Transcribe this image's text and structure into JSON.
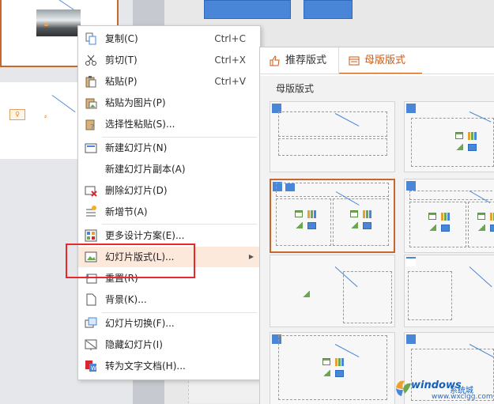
{
  "context_menu": {
    "items": [
      {
        "label": "复制(C)",
        "shortcut": "Ctrl+C",
        "icon": "copy-icon"
      },
      {
        "label": "剪切(T)",
        "shortcut": "Ctrl+X",
        "icon": "cut-icon"
      },
      {
        "label": "粘贴(P)",
        "shortcut": "Ctrl+V",
        "icon": "paste-icon"
      },
      {
        "label": "粘贴为图片(P)",
        "shortcut": "",
        "icon": "paste-as-picture-icon"
      },
      {
        "label": "选择性粘贴(S)...",
        "shortcut": "",
        "icon": "paste-special-icon"
      },
      {
        "label": "新建幻灯片(N)",
        "shortcut": "",
        "icon": "new-slide-icon"
      },
      {
        "label": "新建幻灯片副本(A)",
        "shortcut": "",
        "icon": ""
      },
      {
        "label": "删除幻灯片(D)",
        "shortcut": "",
        "icon": "delete-slide-icon"
      },
      {
        "label": "新增节(A)",
        "shortcut": "",
        "icon": "new-section-icon"
      },
      {
        "label": "更多设计方案(E)...",
        "shortcut": "",
        "icon": "design-scheme-icon"
      },
      {
        "label": "幻灯片版式(L)...",
        "shortcut": "",
        "icon": "slide-layout-icon"
      },
      {
        "label": "重置(R)",
        "shortcut": "",
        "icon": "reset-icon"
      },
      {
        "label": "背景(K)...",
        "shortcut": "",
        "icon": "background-icon"
      },
      {
        "label": "幻灯片切换(F)...",
        "shortcut": "",
        "icon": "slide-transition-icon"
      },
      {
        "label": "隐藏幻灯片(I)",
        "shortcut": "",
        "icon": "hide-slide-icon"
      },
      {
        "label": "转为文字文档(H)...",
        "shortcut": "",
        "icon": "convert-to-doc-icon"
      }
    ],
    "highlighted_item": "幻灯片版式(L)..."
  },
  "layout_panel": {
    "tabs": [
      {
        "label": "推荐版式",
        "icon": "thumbs-up-icon"
      },
      {
        "label": "母版版式",
        "icon": "master-layout-icon",
        "active": true
      }
    ],
    "section_title": "母版版式",
    "selected_layout": "title-and-two-content"
  },
  "watermark": {
    "brand": "windows",
    "sub": "系统城",
    "url": "www.wxclgg.com"
  },
  "colors": {
    "accent": "#c8662c",
    "highlight": "#fde8dc",
    "annotation": "#e8282b",
    "placeholder_blue": "#4a86d8"
  }
}
